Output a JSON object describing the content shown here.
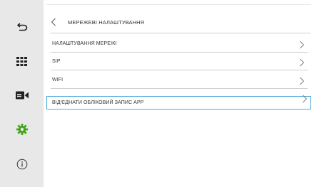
{
  "sidebar": {
    "items": [
      {
        "icon": "back-return-icon"
      },
      {
        "icon": "grid-apps-icon"
      },
      {
        "icon": "video-camera-icon"
      },
      {
        "icon": "gear-icon",
        "active": true,
        "color": "#44a51c"
      },
      {
        "icon": "info-icon"
      }
    ]
  },
  "header": {
    "title": "МЕРЕЖЕВІ НАЛАШТУВАННЯ"
  },
  "menu": {
    "items": [
      {
        "label": "НАЛАШТУВАННЯ МЕРЕЖІ"
      },
      {
        "label": "SIP"
      },
      {
        "label": "WIFI"
      },
      {
        "label": "ВІД'ЄДНАТИ ОБЛІКОВИЙ ЗАПИС APP",
        "selected": true
      }
    ]
  },
  "colors": {
    "sidebar_bg": "#e8e8e8",
    "accent_green": "#44a51c",
    "selection_border": "#4aa8d8",
    "divider": "#cfcfcf"
  }
}
